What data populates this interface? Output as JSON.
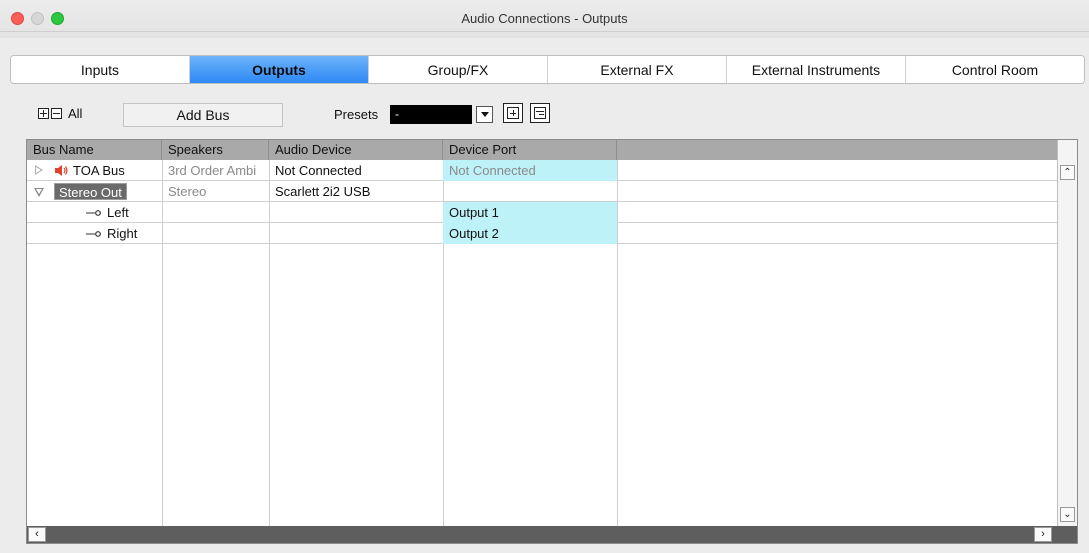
{
  "window": {
    "title": "Audio Connections - Outputs"
  },
  "tabs": [
    {
      "label": "Inputs",
      "active": false
    },
    {
      "label": "Outputs",
      "active": true
    },
    {
      "label": "Group/FX",
      "active": false
    },
    {
      "label": "External FX",
      "active": false
    },
    {
      "label": "External Instruments",
      "active": false
    },
    {
      "label": "Control Room",
      "active": false
    }
  ],
  "toolbar": {
    "all_label": "All",
    "add_bus_label": "Add Bus",
    "presets_label": "Presets",
    "preset_value": "-"
  },
  "table": {
    "columns": [
      "Bus Name",
      "Speakers",
      "Audio Device",
      "Device Port"
    ],
    "rows": [
      {
        "bus_name": "TOA Bus",
        "speakers": "3rd Order Ambi",
        "audio_device": "Not Connected",
        "device_port": "Not Connected",
        "expanded": false,
        "icon": "speaker-icon"
      },
      {
        "bus_name": "Stereo Out",
        "speakers": "Stereo",
        "audio_device": "Scarlett 2i2 USB",
        "device_port": "",
        "expanded": true,
        "selected": true
      },
      {
        "bus_name": "Left",
        "speakers": "",
        "audio_device": "",
        "device_port": "Output 1",
        "icon": "channel-icon"
      },
      {
        "bus_name": "Right",
        "speakers": "",
        "audio_device": "",
        "device_port": "Output 2",
        "icon": "channel-icon"
      }
    ]
  },
  "colors": {
    "active_tab": "#2e88f5",
    "port_highlight": "#bdf2f8",
    "speaker_icon": "#e0432b"
  }
}
